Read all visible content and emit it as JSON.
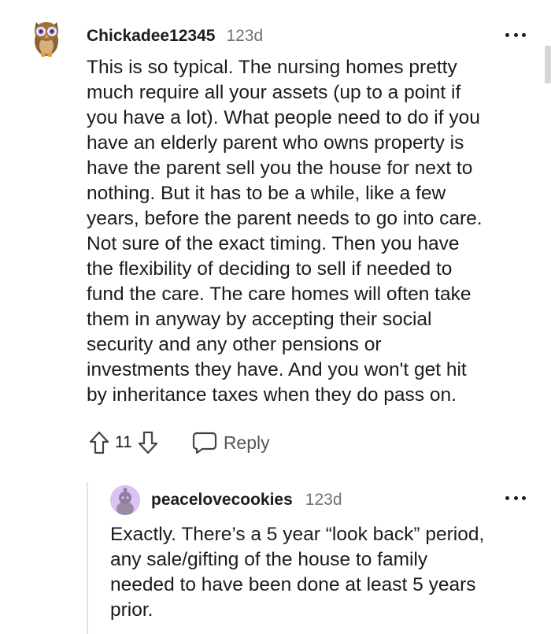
{
  "comment": {
    "username": "Chickadee12345",
    "age": "123d",
    "lines": [
      "This is so typical. The nursing homes pretty",
      "much require all your assets (up to a point if",
      "you have a lot). What people need to do if you",
      "have an elderly parent who owns property is",
      "have the parent sell you the house for next to",
      "nothing. But it has to be a while, like a few",
      "years, before the parent needs to go into care.",
      "Not sure of the exact timing. Then you have",
      "the flexibility of deciding to sell if needed to",
      "fund the care. The care homes will often take",
      "them in anyway by accepting their social",
      "security and any other pensions or",
      "investments they have. And you won't get hit",
      "by inheritance taxes when they do pass on."
    ],
    "vote_count": "11",
    "reply_label": "Reply",
    "upvote_icon": "arrow-up-icon",
    "downvote_icon": "arrow-down-icon",
    "reply_icon": "speech-bubble-icon",
    "more_icon": "ellipsis-icon"
  },
  "reply": {
    "username": "peacelovecookies",
    "age": "123d",
    "lines": [
      "Exactly. There’s a 5 year “look back” period,",
      "any sale/gifting of the house to family",
      "needed to have been done at least 5 years",
      "prior."
    ],
    "more_icon": "ellipsis-icon"
  },
  "colors": {
    "text": "#1c1c1c",
    "meta": "#6f7174",
    "thread_line": "#e3e3e3",
    "reply_avatar_bg": "#dcc1f2"
  }
}
